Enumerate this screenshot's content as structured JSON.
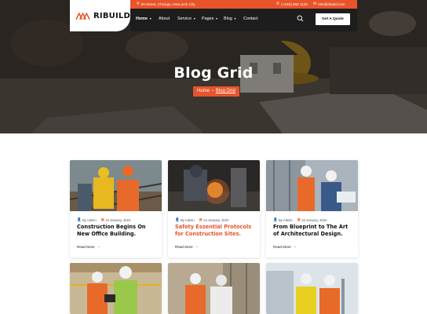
{
  "brand": {
    "name": "RIBUILD",
    "accent": "#e8542a",
    "dark": "#1d1d1d"
  },
  "topbar": {
    "address": "99 Street, Chicago, New york City",
    "phone": "(+245) 592 1126",
    "email": "Info@ribuild.com",
    "address_icon": "location-pin-icon",
    "phone_icon": "phone-icon",
    "email_icon": "envelope-icon"
  },
  "nav": {
    "items": [
      {
        "label": "Home",
        "dropdown": true,
        "active": true
      },
      {
        "label": "About",
        "dropdown": false
      },
      {
        "label": "Service",
        "dropdown": true
      },
      {
        "label": "Pages",
        "dropdown": true
      },
      {
        "label": "Blog",
        "dropdown": true
      },
      {
        "label": "Contact",
        "dropdown": false
      }
    ],
    "search_icon": "search-icon",
    "quote_label": "Get A Quote"
  },
  "hero": {
    "title": "Blog Grid",
    "breadcrumb": {
      "home": "Home",
      "current": "Blog Grid"
    }
  },
  "posts": [
    {
      "author": "By Admin",
      "date": "24 January, 2024",
      "title": "Construction Begins On New Office Building.",
      "link": "Read More"
    },
    {
      "author": "By Admin",
      "date": "24 January, 2024",
      "title": "Safety Essential Protocols for Construction Sites.",
      "link": "Read More"
    },
    {
      "author": "By Admin",
      "date": "24 January, 2024",
      "title": "From Blueprint to The Art of Architectural Design.",
      "link": "Read More"
    },
    {
      "author": "",
      "date": "",
      "title": "",
      "link": ""
    },
    {
      "author": "",
      "date": "",
      "title": "",
      "link": ""
    },
    {
      "author": "",
      "date": "",
      "title": "",
      "link": ""
    }
  ]
}
